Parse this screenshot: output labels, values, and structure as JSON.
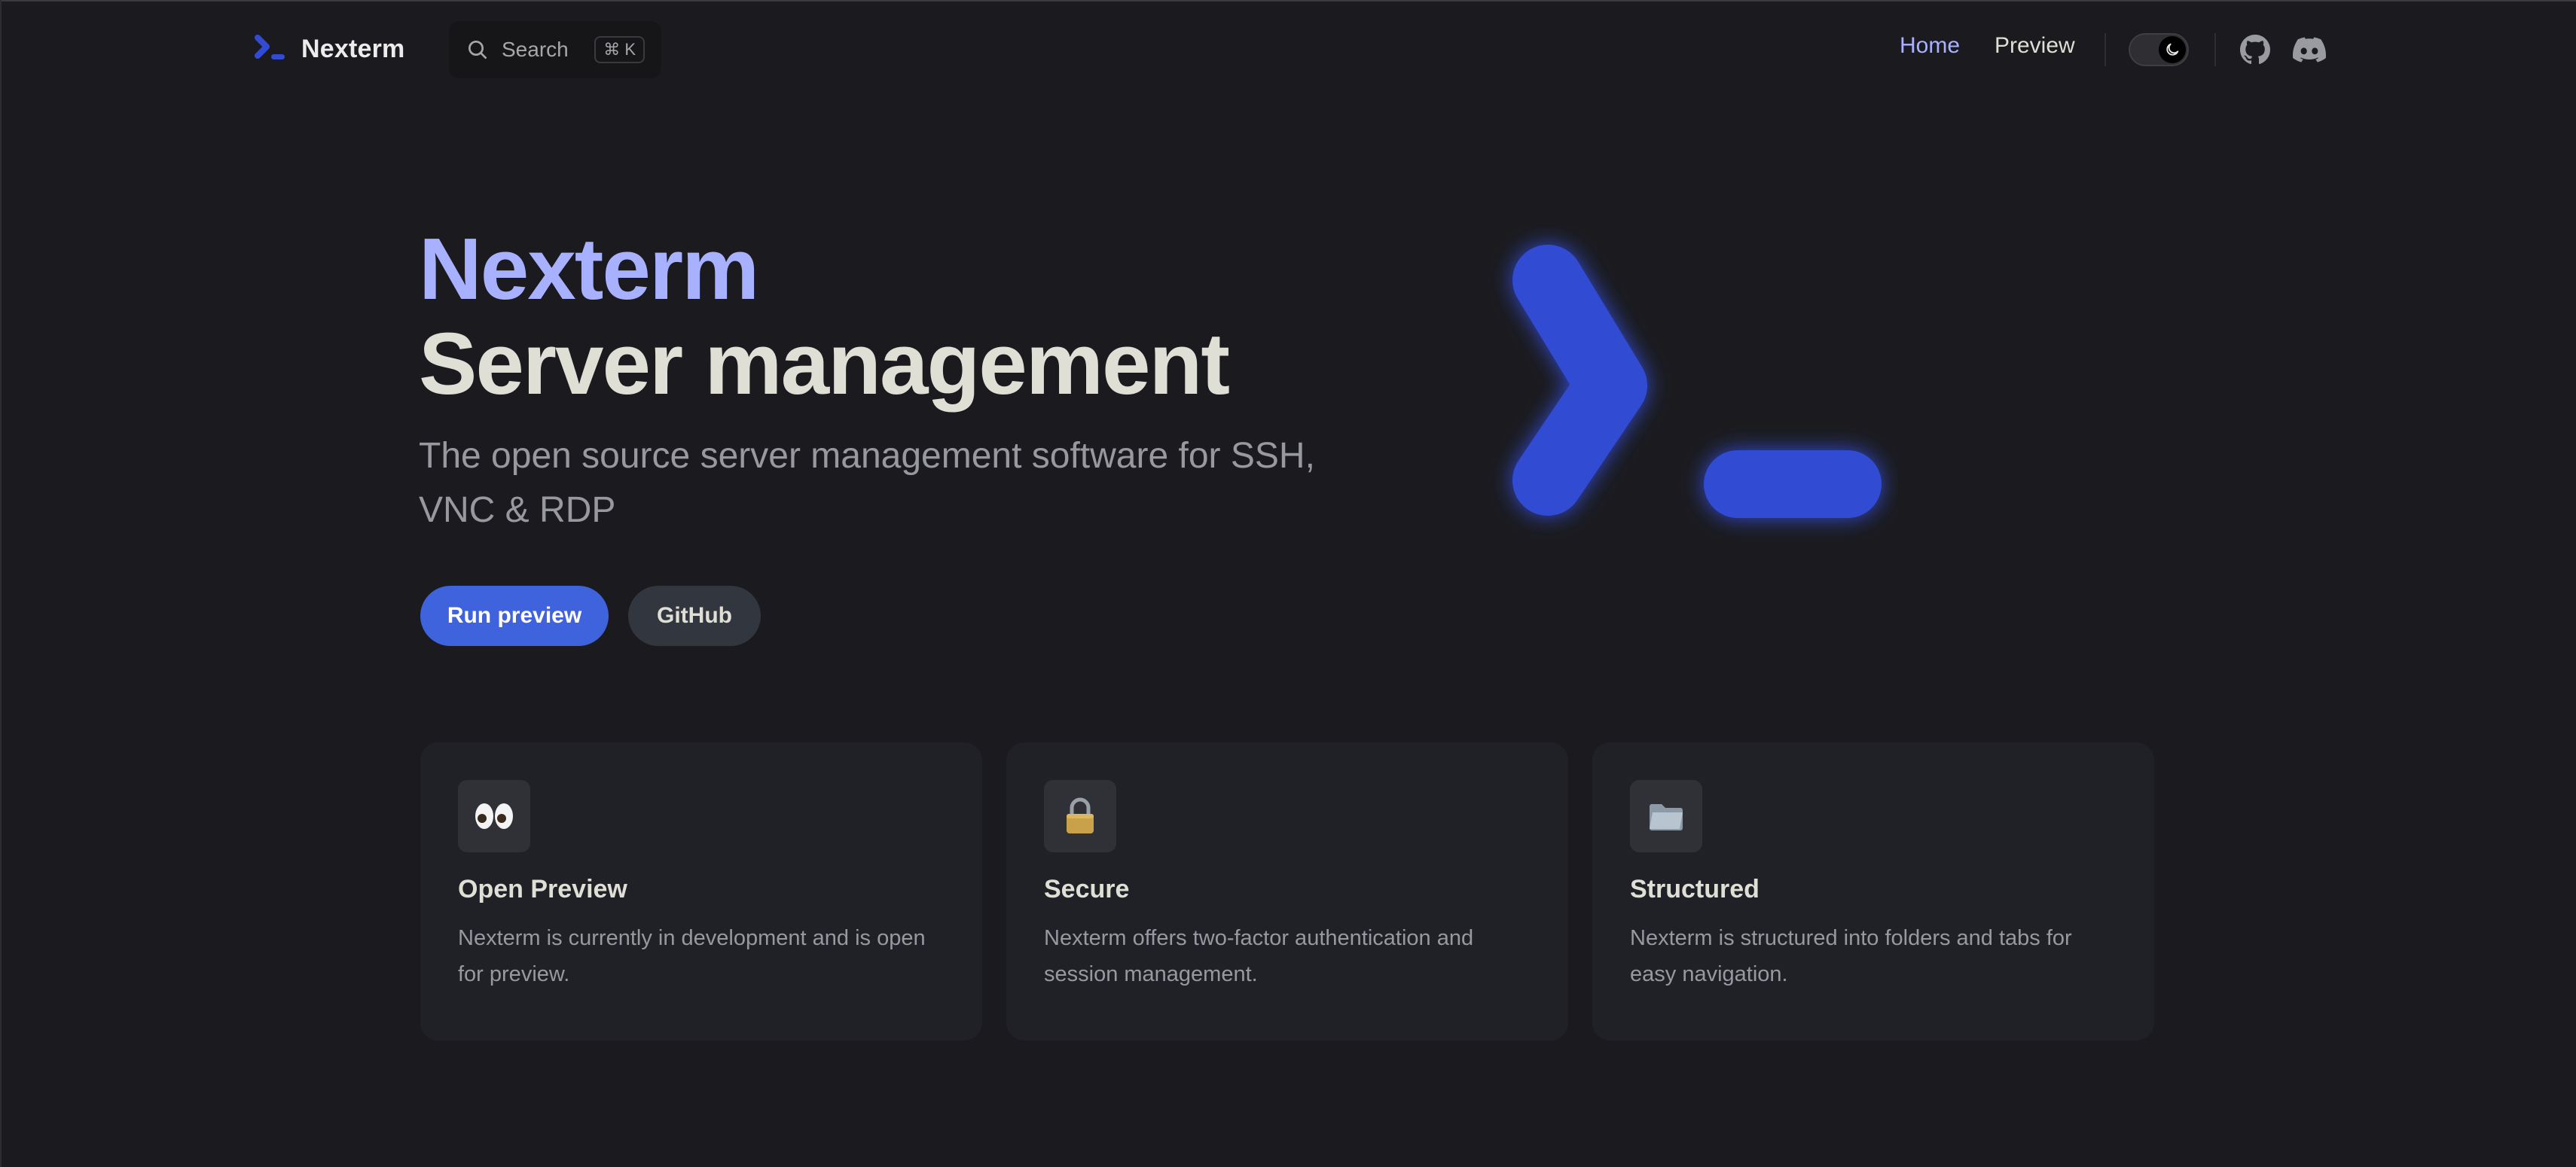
{
  "nav": {
    "brand": "Nexterm",
    "search_label": "Search",
    "search_shortcut": "⌘ K",
    "links": [
      {
        "label": "Home",
        "active": true
      },
      {
        "label": "Preview",
        "active": false
      }
    ],
    "social": [
      "github-icon",
      "discord-icon"
    ],
    "theme_toggle_icon": "moon-icon"
  },
  "hero": {
    "name": "Nexterm",
    "text": "Server management",
    "tagline": "The open source server management software for SSH, VNC & RDP",
    "actions": {
      "primary": "Run preview",
      "secondary": "GitHub"
    }
  },
  "features": [
    {
      "icon": "👀",
      "icon_name": "eyes-icon",
      "title": "Open Preview",
      "details": "Nexterm is currently in development and is open for preview."
    },
    {
      "icon": "🔒",
      "icon_name": "lock-icon",
      "title": "Secure",
      "details": "Nexterm offers two-factor authentication and session management."
    },
    {
      "icon": "📁",
      "icon_name": "folder-icon",
      "title": "Structured",
      "details": "Nexterm is structured into folders and tabs for easy navigation."
    }
  ],
  "colors": {
    "background": "#1b1b1f",
    "brand_accent": "#a8b1ff",
    "logo_blue": "#314bd3",
    "primary_button": "#3e63dd",
    "card_bg": "#202127"
  }
}
